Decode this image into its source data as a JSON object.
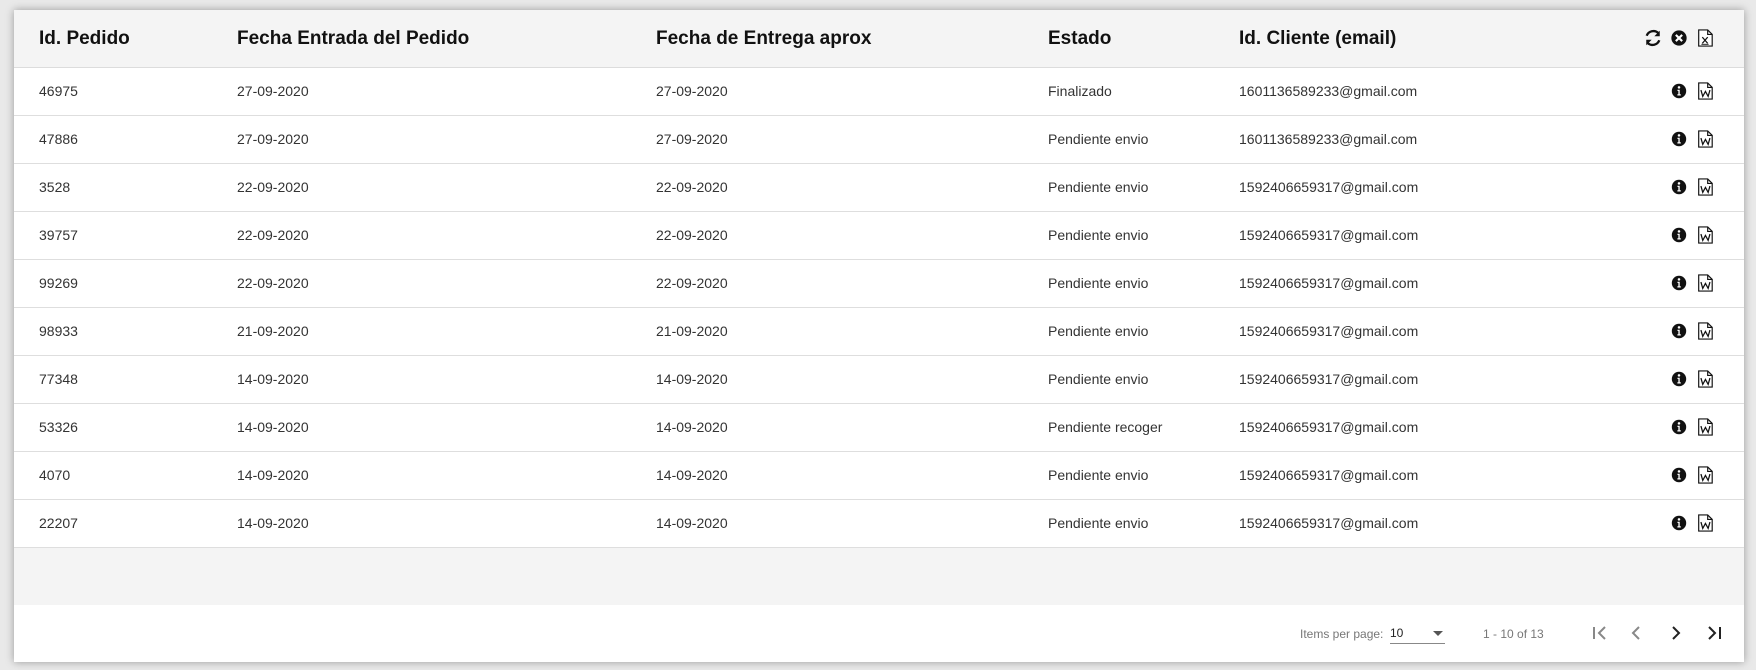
{
  "table": {
    "headers": [
      "Id. Pedido",
      "Fecha Entrada del Pedido",
      "Fecha de Entrega aprox",
      "Estado",
      "Id. Cliente (email)"
    ],
    "rows": [
      [
        "46975",
        "27-09-2020",
        "27-09-2020",
        "Finalizado",
        "1601136589233@gmail.com"
      ],
      [
        "47886",
        "27-09-2020",
        "27-09-2020",
        "Pendiente envio",
        "1601136589233@gmail.com"
      ],
      [
        "3528",
        "22-09-2020",
        "22-09-2020",
        "Pendiente envio",
        "1592406659317@gmail.com"
      ],
      [
        "39757",
        "22-09-2020",
        "22-09-2020",
        "Pendiente envio",
        "1592406659317@gmail.com"
      ],
      [
        "99269",
        "22-09-2020",
        "22-09-2020",
        "Pendiente envio",
        "1592406659317@gmail.com"
      ],
      [
        "98933",
        "21-09-2020",
        "21-09-2020",
        "Pendiente envio",
        "1592406659317@gmail.com"
      ],
      [
        "77348",
        "14-09-2020",
        "14-09-2020",
        "Pendiente envio",
        "1592406659317@gmail.com"
      ],
      [
        "53326",
        "14-09-2020",
        "14-09-2020",
        "Pendiente recoger",
        "1592406659317@gmail.com"
      ],
      [
        "4070",
        "14-09-2020",
        "14-09-2020",
        "Pendiente envio",
        "1592406659317@gmail.com"
      ],
      [
        "22207",
        "14-09-2020",
        "14-09-2020",
        "Pendiente envio",
        "1592406659317@gmail.com"
      ]
    ],
    "header_icons": [
      "refresh-icon",
      "clear-icon",
      "excel-export-icon"
    ],
    "row_icons": [
      "info-icon",
      "word-document-icon"
    ]
  },
  "paginator": {
    "items_per_page_label": "Items per page:",
    "items_per_page_value": "10",
    "range_label": "1 - 10 of 13",
    "buttons": [
      "first-page-icon",
      "previous-page-icon",
      "next-page-icon",
      "last-page-icon"
    ]
  }
}
